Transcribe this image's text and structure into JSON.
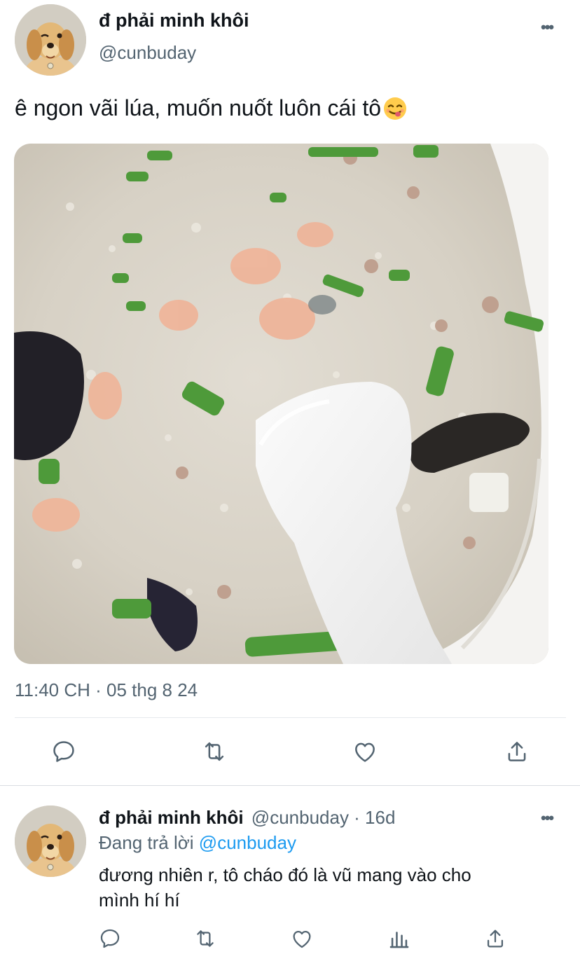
{
  "main_tweet": {
    "display_name": "đ phải minh khôi",
    "handle": "@cunbuday",
    "text": "ê ngon vãi lúa, muốn nuốt luôn cái tô",
    "emoji": "yum-face-emoji",
    "photo": "photo of rice porridge (cháo) with shrimp, minced meat, green onion, century egg and a white spoon",
    "timestamp": "11:40 CH · 05 thg 8 24",
    "actions": [
      "reply-icon",
      "retweet-icon",
      "like-icon",
      "share-icon"
    ]
  },
  "reply": {
    "display_name": "đ phải minh khôi",
    "handle_time": "@cunbuday · 16d",
    "replying_prefix": "Đang trả lời",
    "replying_to": "@cunbuday",
    "text_line1": "đương nhiên r, tô cháo đó là vũ mang vào cho",
    "text_line2": "mình hí hí",
    "actions": [
      "reply-icon",
      "retweet-icon",
      "like-icon",
      "analytics-icon",
      "share-icon"
    ]
  },
  "colors": {
    "text": "#0f1419",
    "muted": "#536471",
    "link": "#1d9bf0",
    "divider": "#e6e9ec"
  }
}
